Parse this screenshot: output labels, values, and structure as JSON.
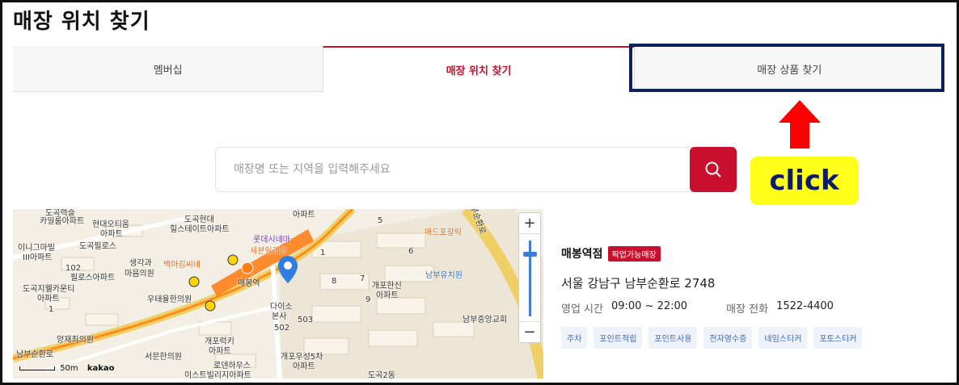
{
  "page": {
    "title": "매장 위치 찾기"
  },
  "tabs": [
    {
      "label": "멤버십",
      "active": false
    },
    {
      "label": "매장 위치 찾기",
      "active": true
    },
    {
      "label": "매장 상품 찾기",
      "active": false
    }
  ],
  "annotation": {
    "click_label": "click",
    "arrow_color": "#ff0000",
    "badge_color": "#ffff1a",
    "highlight_color": "#0b2357"
  },
  "search": {
    "placeholder": "매장명 또는 지역을 입력해주세요",
    "value": "",
    "button_icon": "search-icon"
  },
  "map": {
    "labels": [
      "도곡렉슬",
      "카일룸아파트",
      "현대오티움",
      "아파트",
      "도곡현대",
      "힐스테이트아파트",
      "아파트",
      "롯데시네마",
      "세븐일레븐",
      "매드포갈릭",
      "이니그마빌",
      "III아파트",
      "도곡필로스",
      "102",
      "필로스아파트",
      "생각과",
      "마음의원",
      "백마김씨네",
      "매봉역",
      "남부유치원",
      "개포한신",
      "아파트",
      "도곡지웰카운티",
      "아파트",
      "우태율한의원",
      "다이소",
      "본사",
      "양재최의원",
      "503",
      "502",
      "개포럭키",
      "아파트",
      "남부중앙교회",
      "서문한의원",
      "남부순환로",
      "로덴하우스",
      "이스트빌리지아파트",
      "개포우성5차",
      "아파트",
      "도곡2동",
      "남부순환로",
      "1",
      "1",
      "5",
      "6",
      "7",
      "8",
      "9"
    ],
    "zoom_plus": "+",
    "zoom_minus": "−",
    "scale_label": "50m",
    "brand": "kakao"
  },
  "store": {
    "name": "매봉역점",
    "badge": "픽업가능매장",
    "address": "서울 강남구 남부순환로 2748",
    "hours_label": "영업 시간",
    "hours_value": "09:00 ~ 22:00",
    "phone_label": "매장 전화",
    "phone_value": "1522-4400",
    "tags": [
      "주차",
      "포인트적립",
      "포인트사용",
      "전자영수증",
      "네임스티커",
      "포토스티커"
    ]
  }
}
